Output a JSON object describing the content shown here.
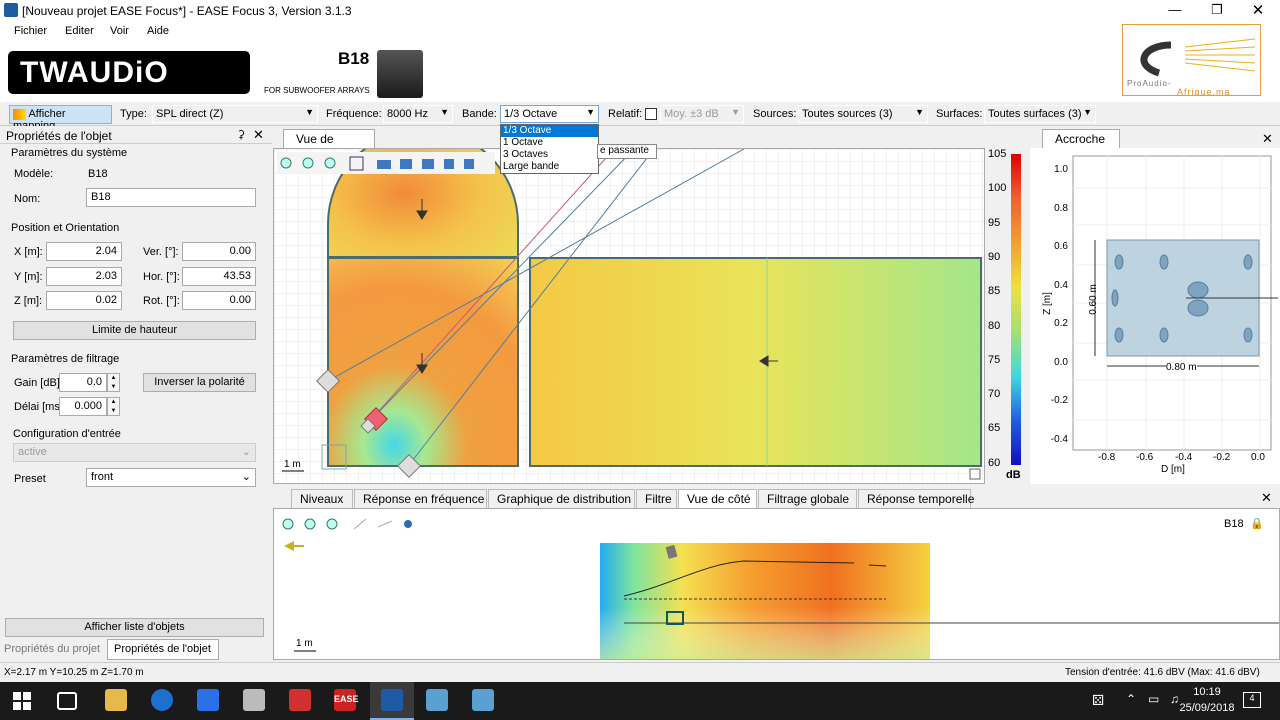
{
  "window": {
    "title": "[Nouveau projet EASE Focus*] - EASE Focus 3, Version 3.1.3"
  },
  "menu": [
    "Fichier",
    "Editer",
    "Voir",
    "Aide"
  ],
  "brand": {
    "logo_text": "TWAUDiO",
    "model": "B18",
    "subtitle": "FOR SUBWOOFER ARRAYS",
    "partner_line1": "ProAudio-",
    "partner_line2": "Afrique.ma"
  },
  "toolbar": {
    "show_mapping": "Afficher mapping",
    "type_label": "Type:",
    "type_value": "SPL direct (Z)",
    "freq_label": "Fréquence:",
    "freq_value": "8000 Hz",
    "band_label": "Bande:",
    "band_value": "1/3 Octave",
    "relatif_label": "Relatif:",
    "moy_value": "Moy. ±3 dB",
    "sources_label": "Sources:",
    "sources_value": "Toutes sources (3)",
    "surfaces_label": "Surfaces:",
    "surfaces_value": "Toutes surfaces (3)"
  },
  "band_dropdown": {
    "options": [
      "1/3 Octave",
      "1 Octave",
      "3 Octaves",
      "Large bande"
    ],
    "tooltip": "e passante"
  },
  "left_panel": {
    "title": "Propriétés de l'objet",
    "system_params": "Paramètres du système",
    "modele_label": "Modèle:",
    "modele_value": "B18",
    "nom_label": "Nom:",
    "nom_value": "B18",
    "position_title": "Position et Orientation",
    "x_label": "X [m]:",
    "x_value": "2.04",
    "y_label": "Y [m]:",
    "y_value": "2.03",
    "z_label": "Z [m]:",
    "z_value": "0.02",
    "ver_label": "Ver. [°]:",
    "ver_value": "0.00",
    "hor_label": "Hor. [°]:",
    "hor_value": "43.53",
    "rot_label": "Rot. [°]:",
    "rot_value": "0.00",
    "height_limit": "Limite de hauteur",
    "filter_title": "Paramètres de filtrage",
    "gain_label": "Gain [dB]:",
    "gain_value": "0.0",
    "invert_polarity": "Inverser la polarité",
    "delay_label": "Délai [ms]",
    "delay_value": "0.000",
    "input_config": "Configuration d'entrée",
    "input_value": "active",
    "preset_label": "Preset",
    "preset_value": "front",
    "show_objects": "Afficher liste d'objets",
    "tab_project": "Propriétés du projet",
    "tab_object": "Propriétés de l'objet"
  },
  "top_view": {
    "tab": "Vue de dessus",
    "scale": "1 m"
  },
  "colorbar": {
    "ticks": [
      "105",
      "100",
      "95",
      "90",
      "85",
      "80",
      "75",
      "70",
      "65",
      "60"
    ],
    "unit": "dB"
  },
  "accroche": {
    "tab": "Accroche",
    "y_ticks": [
      "1.0",
      "0.8",
      "0.6",
      "0.4",
      "0.2",
      "0.0",
      "-0.2",
      "-0.4"
    ],
    "x_ticks": [
      "-0.8",
      "-0.6",
      "-0.4",
      "-0.2",
      "0.0"
    ],
    "y_axis": "Z [m]",
    "x_axis": "D [m]",
    "height_dim": "0.60 m",
    "width_dim": "0.80 m"
  },
  "bottom_tabs": [
    "Niveaux",
    "Réponse en fréquence",
    "Graphique de distribution",
    "Filtre",
    "Vue de côté",
    "Filtrage globale",
    "Réponse temporelle"
  ],
  "side_view": {
    "label": "B18",
    "scale": "1 m"
  },
  "status": {
    "coords": "X=2.17 m Y=10.25 m Z=1.70 m",
    "voltage": "Tension d'entrée: 41.6 dBV (Max: 41.6 dBV)"
  },
  "taskbar": {
    "time": "10:19",
    "date": "25/09/2018",
    "notif": "4"
  }
}
